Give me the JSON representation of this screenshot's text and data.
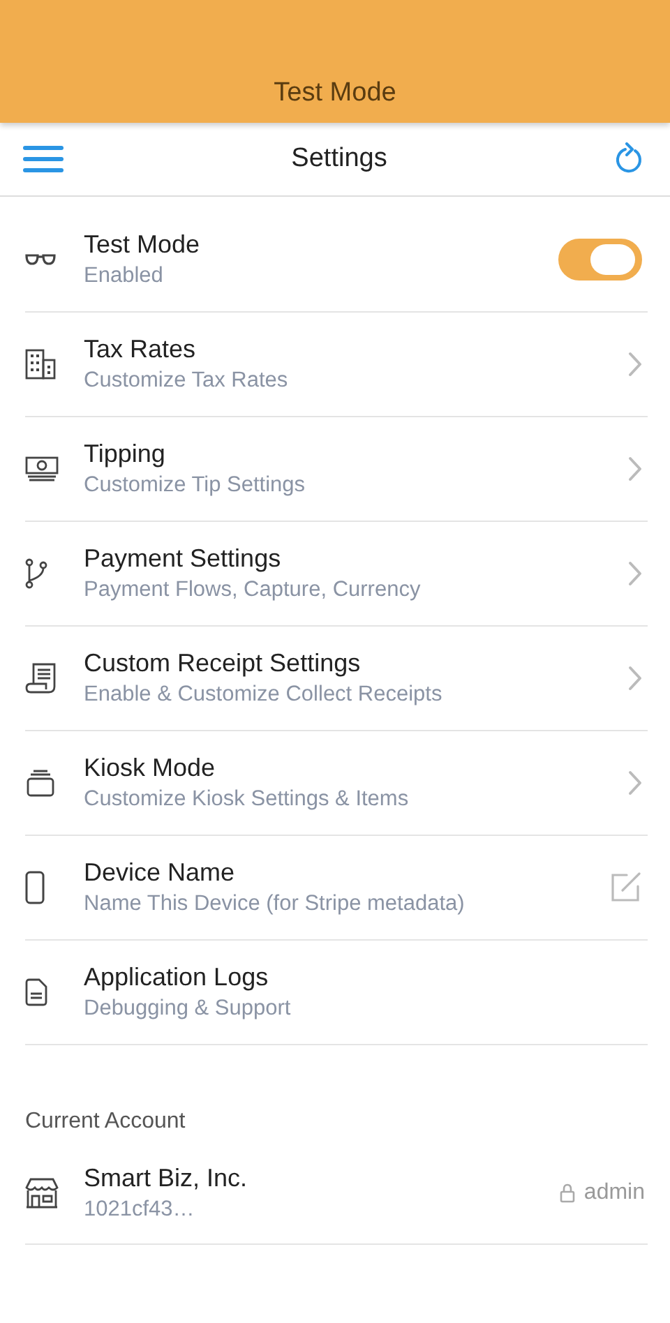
{
  "banner": {
    "title": "Test Mode"
  },
  "nav": {
    "title": "Settings"
  },
  "items": [
    {
      "kind": "toggle",
      "title": "Test Mode",
      "subtitle": "Enabled",
      "on": true
    },
    {
      "kind": "chevron",
      "title": "Tax Rates",
      "subtitle": "Customize Tax Rates"
    },
    {
      "kind": "chevron",
      "title": "Tipping",
      "subtitle": "Customize Tip Settings"
    },
    {
      "kind": "chevron",
      "title": "Payment Settings",
      "subtitle": "Payment Flows, Capture, Currency"
    },
    {
      "kind": "chevron",
      "title": "Custom Receipt Settings",
      "subtitle": "Enable & Customize Collect Receipts"
    },
    {
      "kind": "chevron",
      "title": "Kiosk Mode",
      "subtitle": "Customize Kiosk Settings & Items"
    },
    {
      "kind": "edit",
      "title": "Device Name",
      "subtitle": "Name This Device (for Stripe metadata)"
    },
    {
      "kind": "plain",
      "title": "Application Logs",
      "subtitle": "Debugging & Support"
    }
  ],
  "account": {
    "heading": "Current Account",
    "name": "Smart Biz, Inc.",
    "id": "1021cf43…",
    "role": "admin"
  }
}
